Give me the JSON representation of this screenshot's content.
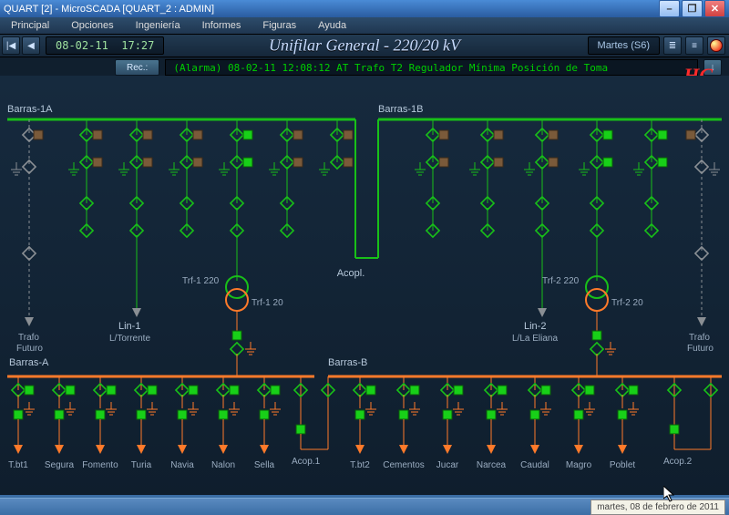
{
  "window": {
    "title": "QUART [2] - MicroSCADA  [QUART_2 : ADMIN]"
  },
  "menu": {
    "principal": "Principal",
    "opciones": "Opciones",
    "ingenieria": "Ingeniería",
    "informes": "Informes",
    "figuras": "Figuras",
    "ayuda": "Ayuda"
  },
  "toolbar": {
    "nav_first": "|◀",
    "nav_prev": "◀",
    "date": "08-02-11",
    "time": "17:27",
    "title": "Unifilar General  - 220/20 kV",
    "day": "Martes  (S6)"
  },
  "alarm": {
    "rec": "Rec.:",
    "text": "(Alarma)  08-02-11 12:08:12  AT Trafo T2    Regulador  Mínima Posición de Toma",
    "download": "↓"
  },
  "logo": "HC",
  "diagram": {
    "busbars": {
      "1a": "Barras-1A",
      "1b": "Barras-1B",
      "a": "Barras-A",
      "b": "Barras-B"
    },
    "acopl": "Acopl.",
    "acop1": "Acop.1",
    "acop2": "Acop.2",
    "trf1_220": "Trf-1 220",
    "trf1_20": "Trf-1 20",
    "trf2_220": "Trf-2 220",
    "trf2_20": "Trf-2 20",
    "lin1": "Lin-1",
    "lin1b": "L/Torrente",
    "lin2": "Lin-2",
    "lin2b": "L/La Eliana",
    "trafo_futuro_a": "Trafo",
    "trafo_futuro_b": "Futuro",
    "feeders1": [
      "T.bt1",
      "Segura",
      "Fomento",
      "Turia",
      "Navia",
      "Nalon",
      "Sella"
    ],
    "feeders2": [
      "T.bt2",
      "Cementos",
      "Jucar",
      "Narcea",
      "Caudal",
      "Magro",
      "Poblet"
    ]
  },
  "status": {
    "tray": "martes, 08 de febrero de 2011"
  },
  "colors": {
    "bus220": "#18c018",
    "bus20": "#ff7a2a",
    "gray": "#9aa0a6",
    "square_on": "#18d018",
    "square_off": "#7a5a3a"
  },
  "chart_data": {
    "type": "network-diagram",
    "voltage_levels": [
      "220 kV",
      "20 kV"
    ],
    "busbars_220": [
      "Barras-1A",
      "Barras-1B"
    ],
    "busbars_20": [
      "Barras-A",
      "Barras-B"
    ],
    "transformers": [
      {
        "name": "Trf-1",
        "hv": "220",
        "lv": "20"
      },
      {
        "name": "Trf-2",
        "hv": "220",
        "lv": "20"
      }
    ],
    "lines_220": [
      "Lin-1 L/Torrente",
      "Lin-2 L/La Eliana"
    ],
    "coupler_220": "Acopl.",
    "couplers_20": [
      "Acop.1",
      "Acop.2"
    ],
    "feeders_busA": [
      "T.bt1",
      "Segura",
      "Fomento",
      "Turia",
      "Navia",
      "Nalon",
      "Sella"
    ],
    "feeders_busB": [
      "T.bt2",
      "Cementos",
      "Jucar",
      "Narcea",
      "Caudal",
      "Magro",
      "Poblet"
    ]
  }
}
